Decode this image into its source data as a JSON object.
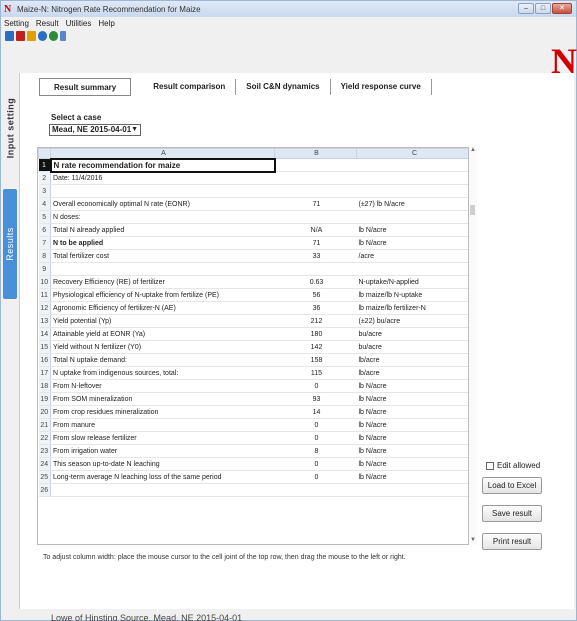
{
  "window": {
    "title": "Maize-N: Nitrogen Rate Recommendation for Maize",
    "icon": "N"
  },
  "menu": [
    "Setting",
    "Result",
    "Utilities",
    "Help"
  ],
  "toolbar": {
    "icons": [
      "new-icon",
      "delete-icon",
      "open-icon",
      "save-icon",
      "run-icon",
      "info-icon"
    ],
    "colors": [
      "#2b6fc2",
      "#c02020",
      "#e0a000",
      "#2b6fc2",
      "#2e8b3a",
      "#5b86c9"
    ]
  },
  "brand": {
    "logo": "N",
    "color": "#d00000"
  },
  "side_tabs": {
    "input": "Input setting",
    "results": "Results"
  },
  "tabs": [
    "Result summary",
    "Result comparison",
    "Soil C&N dynamics",
    "Yield response curve"
  ],
  "active_tab": "Result summary",
  "case": {
    "label": "Select a case",
    "value": "Mead, NE 2015-04-01"
  },
  "grid": {
    "columns": [
      "A",
      "B",
      "C"
    ],
    "rows": [
      [
        "N rate recommendation for maize",
        "",
        ""
      ],
      [
        "Date: 11/4/2016",
        "",
        ""
      ],
      [
        "",
        "",
        ""
      ],
      [
        "Overall economically optimal N rate (EONR)",
        "71",
        "(±27) lb N/acre"
      ],
      [
        "N doses:",
        "",
        ""
      ],
      [
        "   Total N already applied",
        "N/A",
        "lb N/acre"
      ],
      [
        "   N to be applied",
        "71",
        "lb N/acre"
      ],
      [
        "Total fertilizer cost",
        "33",
        "/acre"
      ],
      [
        "",
        "",
        ""
      ],
      [
        "Recovery Efficiency (RE) of fertilizer",
        "0.63",
        "N-uptake/N-applied"
      ],
      [
        "Physiological efficiency of N-uptake from fertilize (PE)",
        "56",
        "lb maize/lb N-uptake"
      ],
      [
        "Agronomic Efficiency of fertilizer-N (AE)",
        "36",
        "lb maize/lb fertilizer-N"
      ],
      [
        "Yield potential (Yp)",
        "212",
        "(±22) bu/acre"
      ],
      [
        "Attainable yield at EONR (Ya)",
        "180",
        "bu/acre"
      ],
      [
        "Yield without N fertilizer (Y0)",
        "142",
        "bu/acre"
      ],
      [
        "Total N uptake demand:",
        "158",
        "lb/acre"
      ],
      [
        "N uptake from indigenous sources, total:",
        "115",
        "lb/acre"
      ],
      [
        "   From N-leftover",
        "0",
        "lb N/acre"
      ],
      [
        "   From SOM mineralization",
        "93",
        "lb N/acre"
      ],
      [
        "   From crop residues mineralization",
        "14",
        "lb N/acre"
      ],
      [
        "   From manure",
        "0",
        "lb N/acre"
      ],
      [
        "   From slow release fertilizer",
        "0",
        "lb N/acre"
      ],
      [
        "   From irrigation water",
        "8",
        "lb N/acre"
      ],
      [
        "This season up-to-date N leaching",
        "0",
        "lb N/acre"
      ],
      [
        "Long-term average N leaching loss of the same period",
        "0",
        "lb N/acre"
      ],
      [
        "",
        "",
        ""
      ]
    ]
  },
  "edit_allowed": {
    "label": "Edit allowed",
    "checked": false
  },
  "buttons": {
    "load_excel": "Load to Excel",
    "save_result": "Save result",
    "print_result": "Print result"
  },
  "hint": "To adjust column width: place the mouse cursor to the cell joint of the top row, then drag the mouse to the left or right.",
  "bottom_cut": "Lowe of Hinsting Source, Mead, NE 2015-04-01"
}
